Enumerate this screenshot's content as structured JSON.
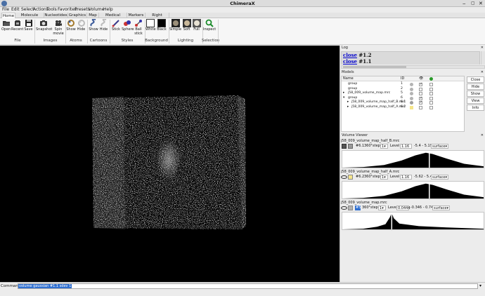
{
  "window": {
    "title": "ChimeraX"
  },
  "menu": [
    "File",
    "Edit",
    "Select",
    "Actions",
    "Tools",
    "Favorites",
    "Presets",
    "Volume",
    "Help"
  ],
  "tabs": [
    "Home",
    "Molecule Display",
    "Nucleotides",
    "Graphics",
    "Map",
    "Medical Image",
    "Markers",
    "Right Mouse"
  ],
  "ribbon": {
    "tools": [
      "Open",
      "Recent",
      "Save",
      "Snapshot",
      "Spin movie",
      "Show",
      "Hide",
      "Show",
      "Hide",
      "Stick",
      "Sphere",
      "Ball stick",
      "White",
      "Black",
      "Simple",
      "Soft",
      "Full",
      "Inspect"
    ],
    "groups": [
      "File",
      "Images",
      "Atoms",
      "Cartoons",
      "Styles",
      "Background",
      "Lighting",
      "Selection"
    ]
  },
  "log": {
    "title": "Log",
    "lines": [
      {
        "link": "close",
        "rest": " #1.2"
      },
      {
        "link": "close",
        "rest": " #1.1"
      }
    ]
  },
  "models": {
    "title": "Models",
    "headers": {
      "name": "Name",
      "id": "ID"
    },
    "rows": [
      {
        "name": "group",
        "id": "1",
        "swatch": "#b3b3b3",
        "shown": true,
        "toggle": ""
      },
      {
        "name": "group",
        "id": "2",
        "swatch": "#b3b3b3",
        "shown": false,
        "toggle": ""
      },
      {
        "name": "j58_009_volume_map.mrc",
        "id": "5",
        "swatch": "#b3b3b3",
        "shown": false,
        "toggle": "▸"
      },
      {
        "name": "group",
        "id": "6",
        "swatch": "#b3b3b3",
        "shown": true,
        "toggle": "▾"
      },
      {
        "name": "j58_009_volume_map_half_B.mrc",
        "id": "6.1",
        "swatch": "#9a9a9a",
        "shown": true,
        "toggle": "▸"
      },
      {
        "name": "j58_009_volume_map_half_A.mrc",
        "id": "6.2",
        "swatch": "#f5e58a",
        "shown": false,
        "toggle": "▸"
      }
    ],
    "buttons": [
      "Close",
      "Hide",
      "Show",
      "View",
      "Info"
    ]
  },
  "volume_viewer": {
    "title": "Volume Viewer",
    "volumes": [
      {
        "file": "j58_009_volume_map_half_B.mrc",
        "id": "#6.1",
        "size": "360³",
        "step_label": "step",
        "step": "1",
        "level_label": "Level",
        "level": "1.16",
        "range": "-5.4 - 5.19",
        "style": "surface"
      },
      {
        "file": "j58_009_volume_map_half_A.mrc",
        "id": "#6.2",
        "size": "360³",
        "step_label": "step",
        "step": "1",
        "level_label": "Level",
        "level": "1.16",
        "range": "-5.62 - 5.47",
        "style": "surface"
      },
      {
        "file": "j58_009_volume_map.mrc",
        "id": "#5",
        "size": "360³",
        "step_label": "step",
        "step": "1",
        "level_label": "Level",
        "level": "0.0444",
        "range": "-0.346 - 0.747",
        "style": "surface"
      }
    ]
  },
  "command": {
    "label": "Command:",
    "value": "volume gaussian #1.1 sdev 1"
  },
  "colors": {
    "viewport_bg": "#000000",
    "link": "#0000cc",
    "selection": "#2f6fd0"
  }
}
